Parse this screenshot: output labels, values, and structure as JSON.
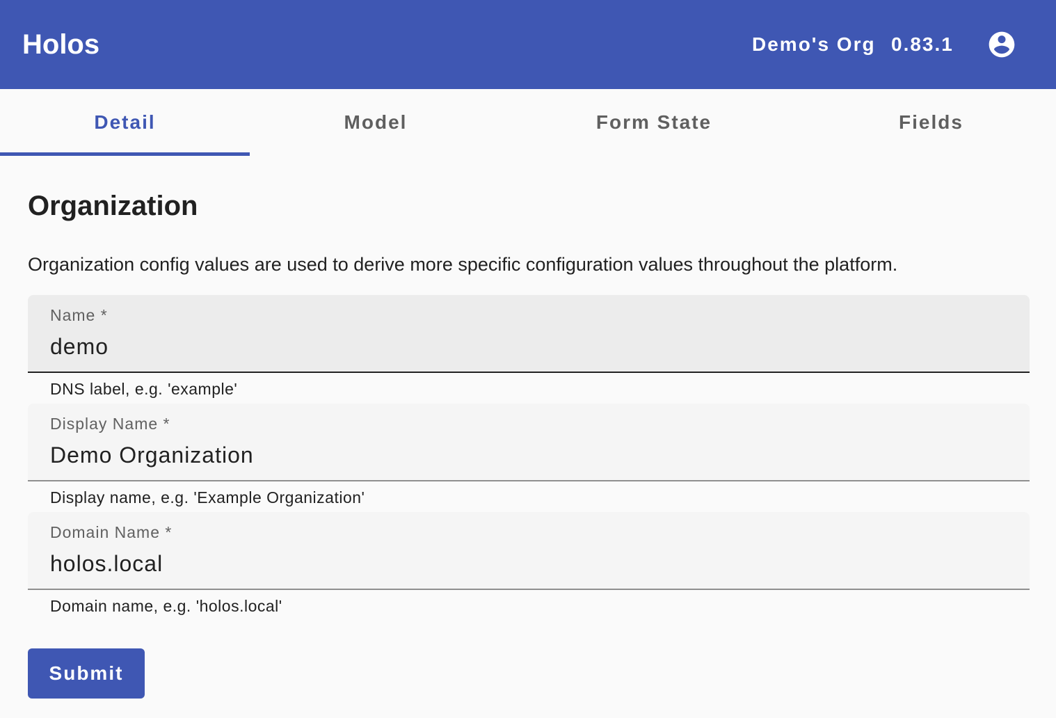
{
  "toolbar": {
    "app_title": "Holos",
    "org_name": "Demo's Org",
    "version": "0.83.1",
    "account_icon": "account-circle-icon",
    "background_color": "#3f57b3"
  },
  "tabs": [
    {
      "label": "Detail",
      "active": true
    },
    {
      "label": "Model",
      "active": false
    },
    {
      "label": "Form State",
      "active": false
    },
    {
      "label": "Fields",
      "active": false
    }
  ],
  "page": {
    "title": "Organization",
    "description": "Organization config values are used to derive more specific configuration values throughout the platform."
  },
  "form": {
    "fields": [
      {
        "label": "Name *",
        "value": "demo",
        "hint": "DNS label, e.g. 'example'",
        "focused": true
      },
      {
        "label": "Display Name *",
        "value": "Demo Organization",
        "hint": "Display name, e.g. 'Example Organization'",
        "focused": false
      },
      {
        "label": "Domain Name *",
        "value": "holos.local",
        "hint": "Domain name, e.g. 'holos.local'",
        "focused": false
      }
    ],
    "submit_label": "Submit"
  }
}
